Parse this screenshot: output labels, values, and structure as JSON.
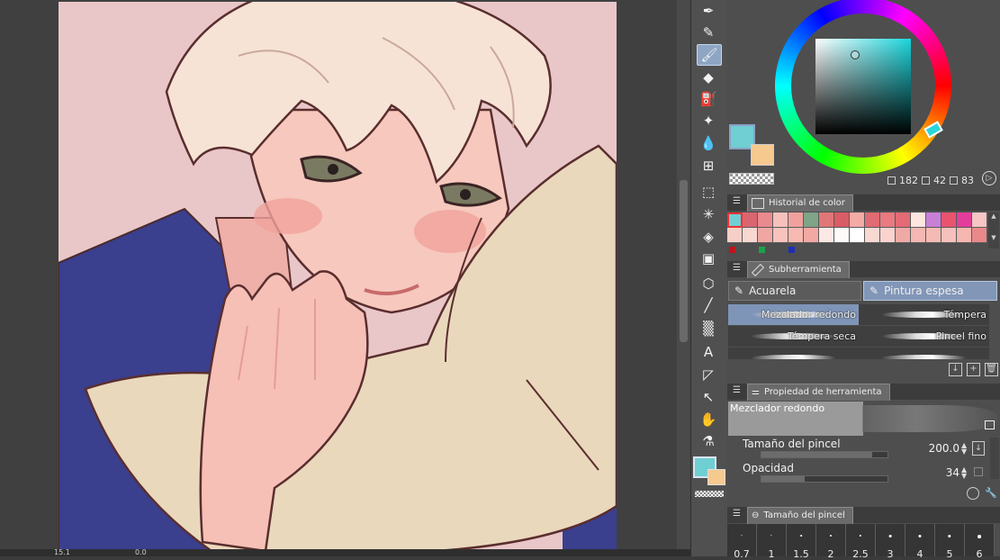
{
  "canvas": {
    "status": {
      "zoom": "15.1",
      "rotation": "0.0"
    }
  },
  "toolbar": {
    "tools": [
      {
        "name": "pen-tool",
        "glyph": "✒"
      },
      {
        "name": "pencil-tool",
        "glyph": "✎"
      },
      {
        "name": "brush-tool",
        "glyph": "🖌"
      },
      {
        "name": "eraser-tool",
        "glyph": "◆"
      },
      {
        "name": "airbrush-tool",
        "glyph": "⛽"
      },
      {
        "name": "decoration-tool",
        "glyph": "✦"
      },
      {
        "name": "blend-tool",
        "glyph": "💧"
      },
      {
        "name": "figure-tool",
        "glyph": "⊞"
      },
      {
        "name": "selection-tool",
        "glyph": "⬚"
      },
      {
        "name": "auto-select-tool",
        "glyph": "✳"
      },
      {
        "name": "fill-tool",
        "glyph": "◈"
      },
      {
        "name": "gradient-tool",
        "glyph": "▣"
      },
      {
        "name": "3d-object-tool",
        "glyph": "⬡"
      },
      {
        "name": "line-tool",
        "glyph": "╱"
      },
      {
        "name": "frame-tool",
        "glyph": "▒"
      },
      {
        "name": "text-tool",
        "glyph": "A"
      },
      {
        "name": "balloon-tool",
        "glyph": "◸"
      },
      {
        "name": "operation-tool",
        "glyph": "↖"
      },
      {
        "name": "hand-tool",
        "glyph": "✋"
      },
      {
        "name": "eyedropper-tool",
        "glyph": "⚗"
      }
    ],
    "main_color": "#6fcfd2",
    "sub_color": "#f6c98f"
  },
  "color_wheel": {
    "main_color": "#6fcfd2",
    "sub_color": "#f6c98f",
    "h": "182",
    "s": "42",
    "v": "83"
  },
  "history": {
    "title": "Historial de color",
    "rows": [
      [
        "#6fcfd2",
        "#d9666f",
        "#e88a8e",
        "#f6c1bd",
        "#f0a19e",
        "#7fa487",
        "#e07677",
        "#d95c66",
        "#f3aba5",
        "#e06b72",
        "#e87a80",
        "#e26b75",
        "#fde6df",
        "#c880d6",
        "#e8546f",
        "#e33d9b",
        "#f6c5c5"
      ],
      [
        "#f6cfc7",
        "#f9d7d1",
        "#f0a7a3",
        "#f9c3bd",
        "#f8b9b2",
        "#f2a9a4",
        "#fde8e4",
        "#fffafa",
        "#ffffff",
        "#f9d8d2",
        "#fbd3ce",
        "#f0aaa6",
        "#f4b7b3",
        "#f5bab4",
        "#f6c1bc",
        "#f6b7b0",
        "#e9898a"
      ]
    ],
    "basic": [
      "#c0141a",
      "#1ea04a",
      "#1d2fb8"
    ]
  },
  "subtool": {
    "title": "Subherramienta",
    "groups": [
      "Acuarela",
      "Pintura espesa"
    ],
    "brushes": [
      "Mezclador redondo",
      "Témpera",
      "Témpera seca",
      "Pincel fino",
      "",
      ""
    ]
  },
  "properties": {
    "title": "Propiedad de herramienta",
    "preview_name": "Mezclador redondo",
    "size_label": "Tamaño del pincel",
    "size_value": "200.0",
    "size_fraction": 0.88,
    "opacity_label": "Opacidad",
    "opacity_value": "34",
    "opacity_fraction": 0.34
  },
  "brush_size": {
    "title": "Tamaño del pincel",
    "sizes": [
      "0.7",
      "1",
      "1.5",
      "2",
      "2.5",
      "3",
      "4",
      "5",
      "6"
    ]
  }
}
